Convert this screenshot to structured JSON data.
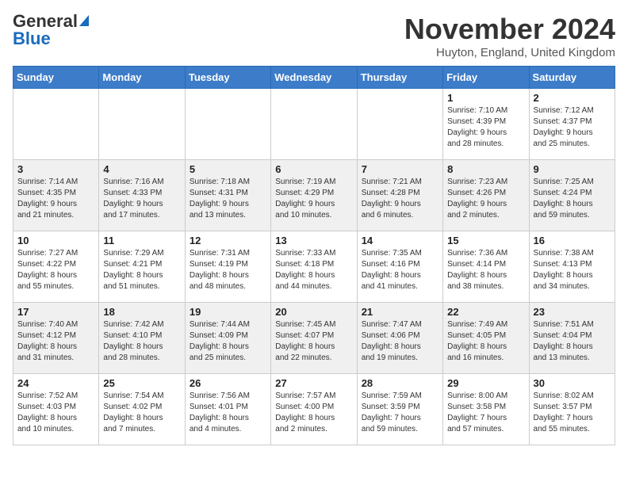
{
  "header": {
    "logo_general": "General",
    "logo_blue": "Blue",
    "month_title": "November 2024",
    "location": "Huyton, England, United Kingdom"
  },
  "weekdays": [
    "Sunday",
    "Monday",
    "Tuesday",
    "Wednesday",
    "Thursday",
    "Friday",
    "Saturday"
  ],
  "weeks": [
    [
      {
        "day": "",
        "info": ""
      },
      {
        "day": "",
        "info": ""
      },
      {
        "day": "",
        "info": ""
      },
      {
        "day": "",
        "info": ""
      },
      {
        "day": "",
        "info": ""
      },
      {
        "day": "1",
        "info": "Sunrise: 7:10 AM\nSunset: 4:39 PM\nDaylight: 9 hours\nand 28 minutes."
      },
      {
        "day": "2",
        "info": "Sunrise: 7:12 AM\nSunset: 4:37 PM\nDaylight: 9 hours\nand 25 minutes."
      }
    ],
    [
      {
        "day": "3",
        "info": "Sunrise: 7:14 AM\nSunset: 4:35 PM\nDaylight: 9 hours\nand 21 minutes."
      },
      {
        "day": "4",
        "info": "Sunrise: 7:16 AM\nSunset: 4:33 PM\nDaylight: 9 hours\nand 17 minutes."
      },
      {
        "day": "5",
        "info": "Sunrise: 7:18 AM\nSunset: 4:31 PM\nDaylight: 9 hours\nand 13 minutes."
      },
      {
        "day": "6",
        "info": "Sunrise: 7:19 AM\nSunset: 4:29 PM\nDaylight: 9 hours\nand 10 minutes."
      },
      {
        "day": "7",
        "info": "Sunrise: 7:21 AM\nSunset: 4:28 PM\nDaylight: 9 hours\nand 6 minutes."
      },
      {
        "day": "8",
        "info": "Sunrise: 7:23 AM\nSunset: 4:26 PM\nDaylight: 9 hours\nand 2 minutes."
      },
      {
        "day": "9",
        "info": "Sunrise: 7:25 AM\nSunset: 4:24 PM\nDaylight: 8 hours\nand 59 minutes."
      }
    ],
    [
      {
        "day": "10",
        "info": "Sunrise: 7:27 AM\nSunset: 4:22 PM\nDaylight: 8 hours\nand 55 minutes."
      },
      {
        "day": "11",
        "info": "Sunrise: 7:29 AM\nSunset: 4:21 PM\nDaylight: 8 hours\nand 51 minutes."
      },
      {
        "day": "12",
        "info": "Sunrise: 7:31 AM\nSunset: 4:19 PM\nDaylight: 8 hours\nand 48 minutes."
      },
      {
        "day": "13",
        "info": "Sunrise: 7:33 AM\nSunset: 4:18 PM\nDaylight: 8 hours\nand 44 minutes."
      },
      {
        "day": "14",
        "info": "Sunrise: 7:35 AM\nSunset: 4:16 PM\nDaylight: 8 hours\nand 41 minutes."
      },
      {
        "day": "15",
        "info": "Sunrise: 7:36 AM\nSunset: 4:14 PM\nDaylight: 8 hours\nand 38 minutes."
      },
      {
        "day": "16",
        "info": "Sunrise: 7:38 AM\nSunset: 4:13 PM\nDaylight: 8 hours\nand 34 minutes."
      }
    ],
    [
      {
        "day": "17",
        "info": "Sunrise: 7:40 AM\nSunset: 4:12 PM\nDaylight: 8 hours\nand 31 minutes."
      },
      {
        "day": "18",
        "info": "Sunrise: 7:42 AM\nSunset: 4:10 PM\nDaylight: 8 hours\nand 28 minutes."
      },
      {
        "day": "19",
        "info": "Sunrise: 7:44 AM\nSunset: 4:09 PM\nDaylight: 8 hours\nand 25 minutes."
      },
      {
        "day": "20",
        "info": "Sunrise: 7:45 AM\nSunset: 4:07 PM\nDaylight: 8 hours\nand 22 minutes."
      },
      {
        "day": "21",
        "info": "Sunrise: 7:47 AM\nSunset: 4:06 PM\nDaylight: 8 hours\nand 19 minutes."
      },
      {
        "day": "22",
        "info": "Sunrise: 7:49 AM\nSunset: 4:05 PM\nDaylight: 8 hours\nand 16 minutes."
      },
      {
        "day": "23",
        "info": "Sunrise: 7:51 AM\nSunset: 4:04 PM\nDaylight: 8 hours\nand 13 minutes."
      }
    ],
    [
      {
        "day": "24",
        "info": "Sunrise: 7:52 AM\nSunset: 4:03 PM\nDaylight: 8 hours\nand 10 minutes."
      },
      {
        "day": "25",
        "info": "Sunrise: 7:54 AM\nSunset: 4:02 PM\nDaylight: 8 hours\nand 7 minutes."
      },
      {
        "day": "26",
        "info": "Sunrise: 7:56 AM\nSunset: 4:01 PM\nDaylight: 8 hours\nand 4 minutes."
      },
      {
        "day": "27",
        "info": "Sunrise: 7:57 AM\nSunset: 4:00 PM\nDaylight: 8 hours\nand 2 minutes."
      },
      {
        "day": "28",
        "info": "Sunrise: 7:59 AM\nSunset: 3:59 PM\nDaylight: 7 hours\nand 59 minutes."
      },
      {
        "day": "29",
        "info": "Sunrise: 8:00 AM\nSunset: 3:58 PM\nDaylight: 7 hours\nand 57 minutes."
      },
      {
        "day": "30",
        "info": "Sunrise: 8:02 AM\nSunset: 3:57 PM\nDaylight: 7 hours\nand 55 minutes."
      }
    ]
  ]
}
